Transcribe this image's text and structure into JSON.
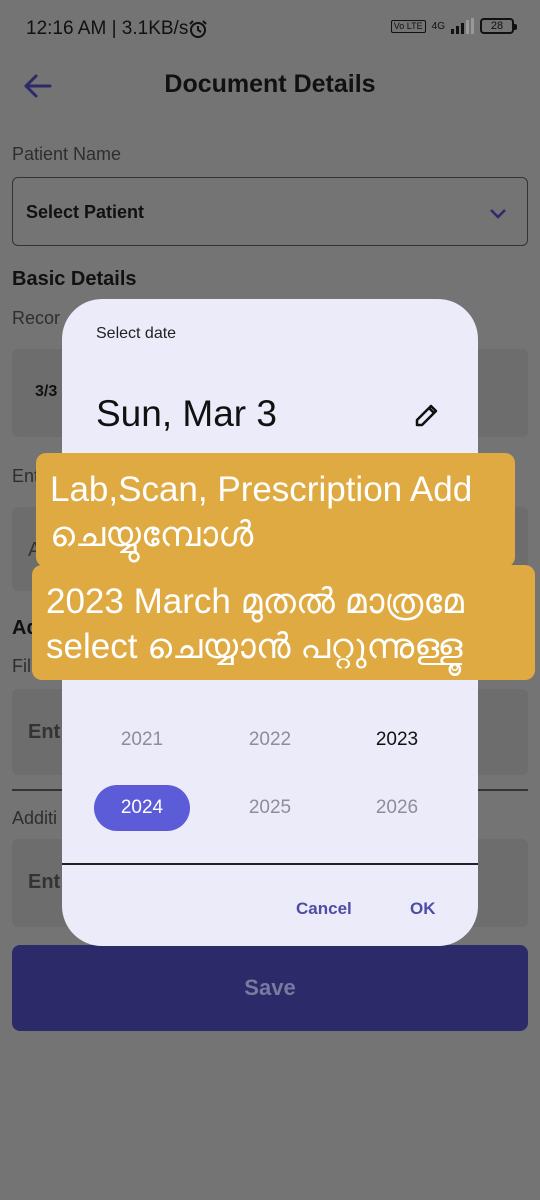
{
  "status_bar": {
    "time": "12:16 AM",
    "separator": "|",
    "speed": "3.1KB/s",
    "alarm_icon": "alarm-clock-icon",
    "network_badge": "Vo LTE",
    "network_type": "4G",
    "battery": "28"
  },
  "appbar": {
    "back_icon": "arrow-left-icon",
    "title": "Document Details"
  },
  "form": {
    "patient_label": "Patient Name",
    "patient_select_value": "Select Patient",
    "basic_details_heading": "Basic Details",
    "record_label_partial": "Recor",
    "record_date_partial": "3/3",
    "entry_label_partial": "Ent",
    "field2_partial": "A",
    "section2_heading_partial": "Ad",
    "file_label_partial": "Fil",
    "file_field_partial": "Ent",
    "additional_label_partial": "Additi",
    "additional_field_partial": "Ent",
    "save_label": "Save"
  },
  "date_picker": {
    "helper": "Select date",
    "headline": "Sun, Mar 3",
    "edit_icon": "pencil-icon",
    "years": [
      "2021",
      "2022",
      "2023",
      "2024",
      "2025",
      "2026"
    ],
    "current_year": "2023",
    "selected_year": "2024",
    "cancel_label": "Cancel",
    "ok_label": "OK"
  },
  "annotations": {
    "note1_line1": "Lab,Scan, Prescription Add",
    "note1_line2": "ചെയ്യുമ്പോൾ",
    "note2_line1": "2023 March മുതൽ മാത്രമേ",
    "note2_line2": "select ചെയ്യാൻ പറ്റുന്നുള്ളൂ"
  },
  "colors": {
    "scrim": "#747474",
    "dialog_bg": "#ecebfa",
    "accent": "#5c5bd8",
    "save_button": "#2c2a69",
    "annotation": "#dfaa42"
  }
}
